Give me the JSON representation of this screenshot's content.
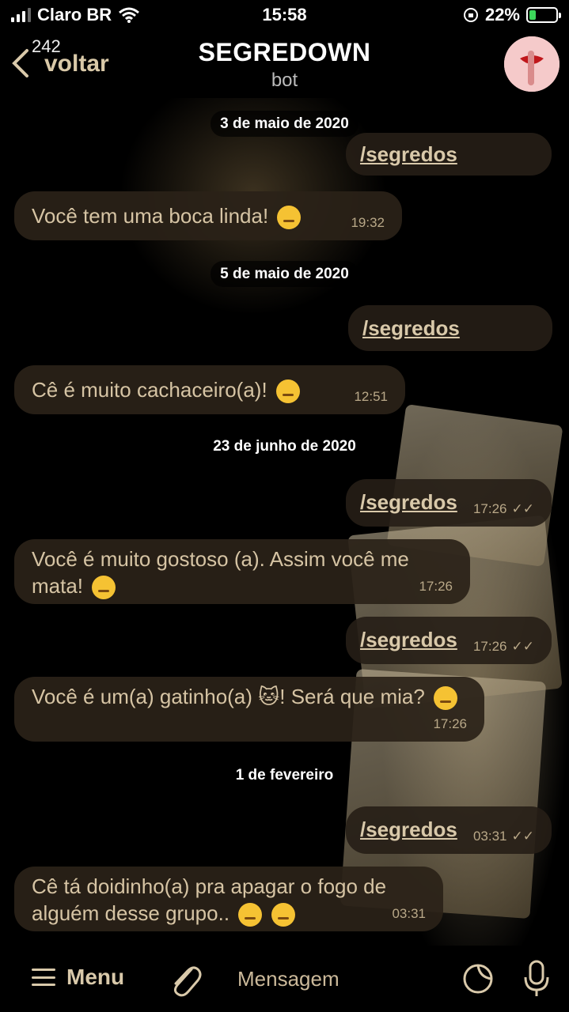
{
  "status_bar": {
    "carrier": "Claro BR",
    "time": "15:58",
    "battery": "22%"
  },
  "header": {
    "back_count": "242",
    "back_label": "voltar",
    "title": "SEGREDOWN",
    "subtitle": "bot"
  },
  "messages": [
    {
      "type": "date",
      "text": "3 de maio de 2020"
    },
    {
      "type": "out",
      "text": "/segredos",
      "time": ""
    },
    {
      "type": "in",
      "text": "Você tem uma boca linda!",
      "time": "19:32"
    },
    {
      "type": "date",
      "text": "5 de maio de 2020"
    },
    {
      "type": "out",
      "text": "/segredos",
      "time": ""
    },
    {
      "type": "in",
      "text": "Cê é muito cachaceiro(a)!",
      "time": "12:51"
    },
    {
      "type": "date",
      "text": "23 de junho de 2020"
    },
    {
      "type": "out",
      "text": "/segredos",
      "time": "17:26"
    },
    {
      "type": "in",
      "text": "Você é muito gostoso (a). Assim você me mata!",
      "time": "17:26"
    },
    {
      "type": "out",
      "text": "/segredos",
      "time": "17:26"
    },
    {
      "type": "in",
      "text": "Você é um(a) gatinho(a) 🐱! Será que mia?",
      "time": "17:26"
    },
    {
      "type": "date",
      "text": "1 de fevereiro"
    },
    {
      "type": "out",
      "text": "/segredos",
      "time": "03:31"
    },
    {
      "type": "in",
      "text": "Cê tá doidinho(a) pra apagar o fogo de alguém desse grupo..",
      "time": "03:31"
    }
  ],
  "bottom_bar": {
    "menu_label": "Menu",
    "input_placeholder": "Mensagem"
  },
  "icons": {
    "back": "chevron-left-icon",
    "attach": "paperclip-icon",
    "sticker": "sticker-icon",
    "mic": "microphone-icon",
    "menu": "hamburger-icon"
  },
  "colors": {
    "accent_text": "#d9c9aa",
    "bubble": "#2a2218",
    "battery_fill": "#3cd65a"
  }
}
